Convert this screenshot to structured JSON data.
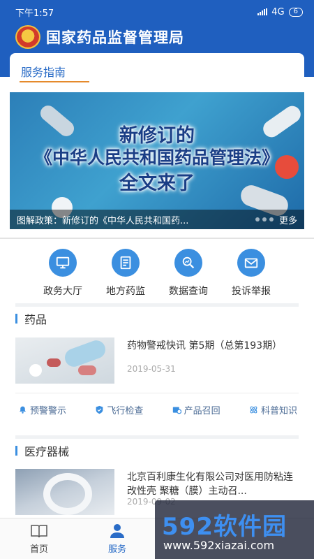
{
  "status_bar": {
    "time": "下午1:57",
    "network": "4G",
    "battery": "6"
  },
  "header": {
    "title": "国家药品监督管理局"
  },
  "guide": {
    "tab_label": "服务指南"
  },
  "banner": {
    "headline_1": "新修订的",
    "headline_2": "《中华人民共和国药品管理法》",
    "headline_3": "全文来了",
    "caption": "图解政策：新修订的《中华人民共和国药...",
    "more": "更多"
  },
  "quick_links": [
    {
      "label": "政务大厅",
      "icon": "computer-icon"
    },
    {
      "label": "地方药监",
      "icon": "document-list-icon"
    },
    {
      "label": "数据查询",
      "icon": "magnifier-chart-icon"
    },
    {
      "label": "投诉举报",
      "icon": "envelope-icon"
    }
  ],
  "drugs": {
    "section_title": "药品",
    "news": {
      "title": "药物警戒快讯 第5期（总第193期）",
      "date": "2019-05-31"
    },
    "subnav": [
      {
        "label": "预警警示",
        "icon": "bell-icon"
      },
      {
        "label": "飞行检查",
        "icon": "shield-check-icon"
      },
      {
        "label": "产品召回",
        "icon": "recall-icon"
      },
      {
        "label": "科普知识",
        "icon": "atom-icon"
      }
    ]
  },
  "devices": {
    "section_title": "医疗器械",
    "news": {
      "title": "北京百利康生化有限公司对医用防粘连改性壳 聚糖（膜）主动召...",
      "date": "2019-09-02"
    }
  },
  "tabbar": {
    "items": [
      {
        "label": "首页",
        "active": false
      },
      {
        "label": "服务",
        "active": true
      }
    ]
  },
  "watermark": {
    "brand": "592软件园",
    "url": "www.592xiazai.com"
  },
  "colors": {
    "primary": "#1f5fbf",
    "accent": "#3b8fe0",
    "tab_underline": "#e58a2c"
  }
}
